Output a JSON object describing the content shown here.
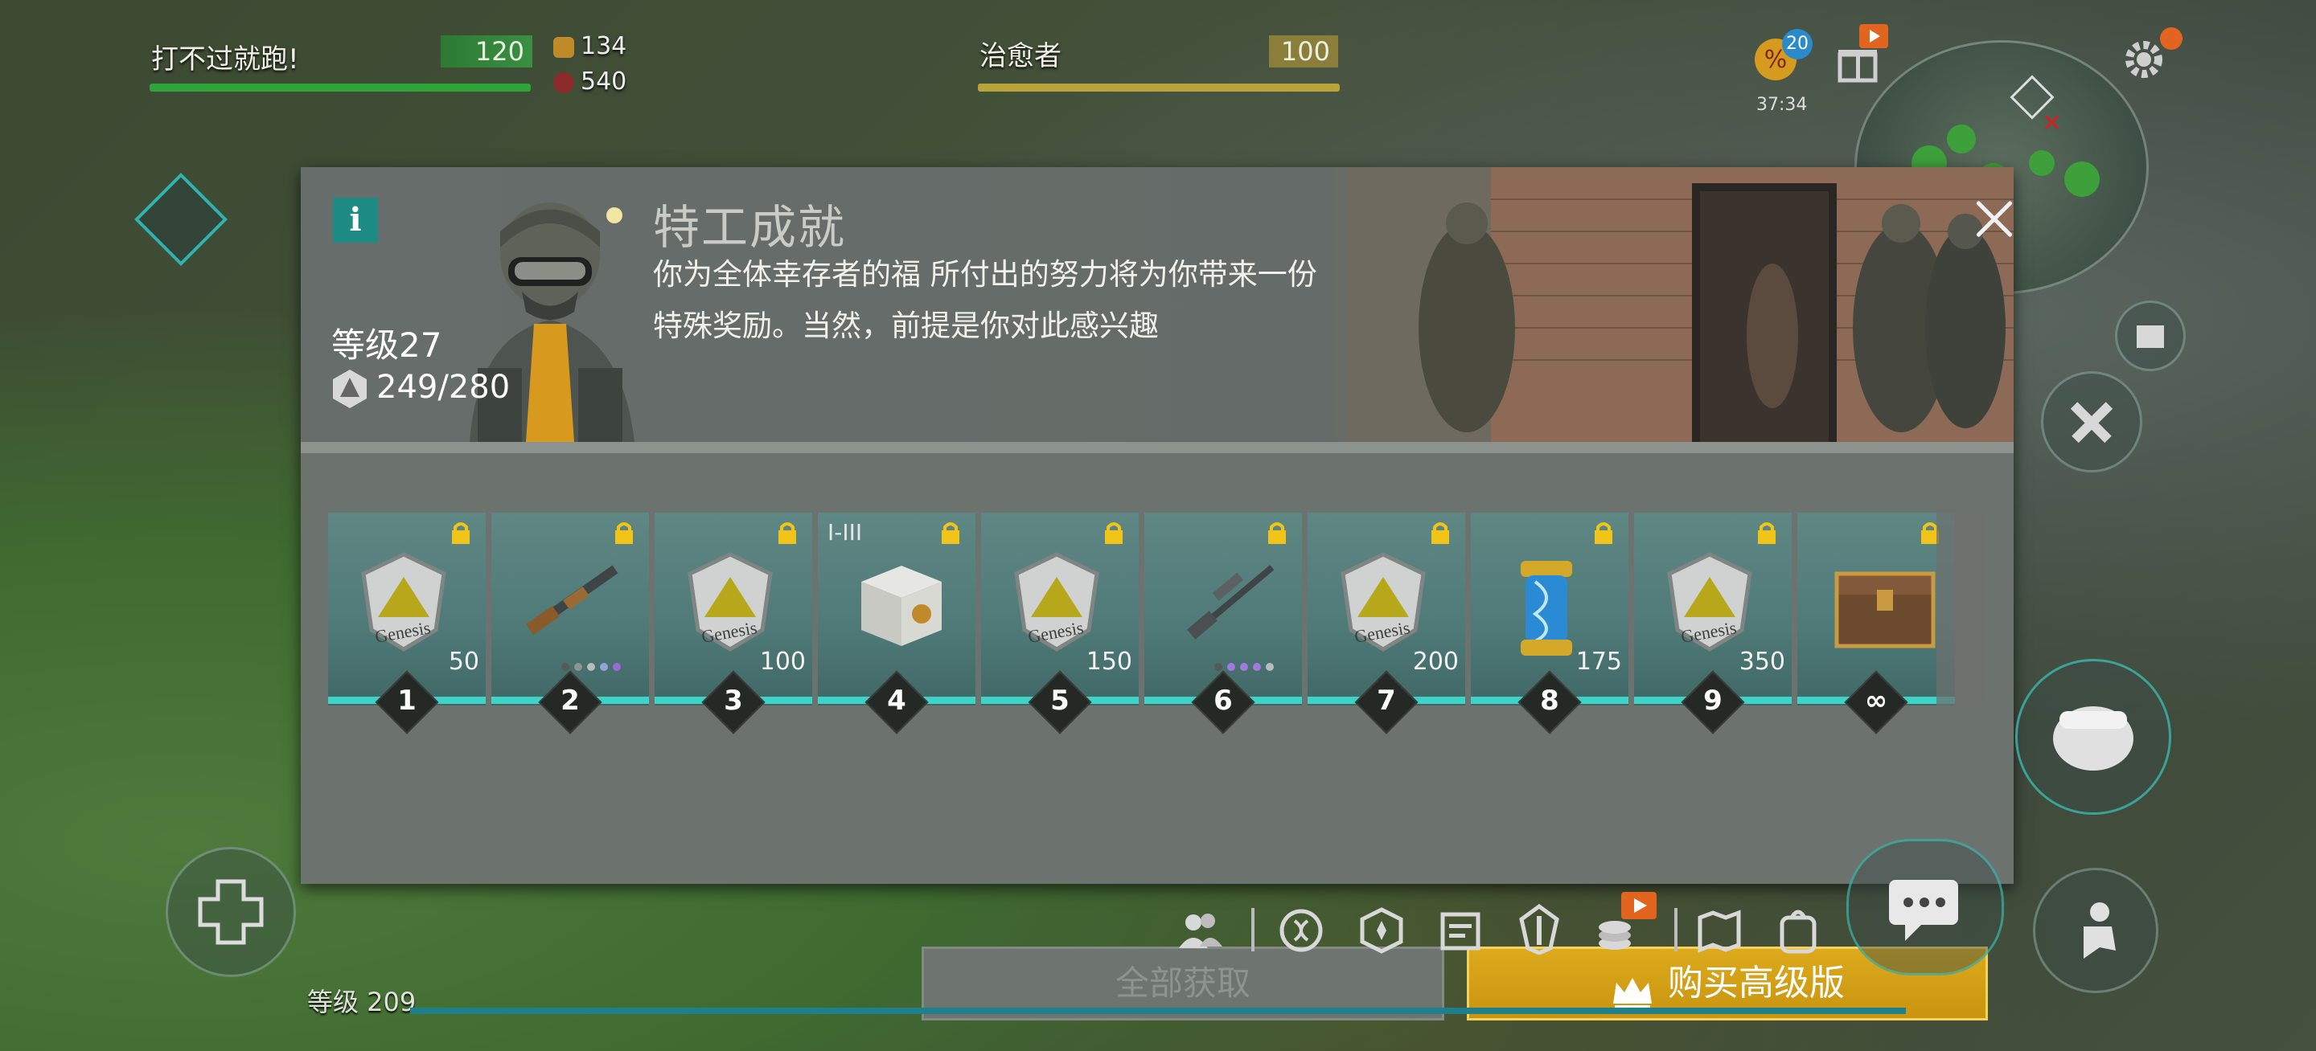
{
  "hud": {
    "player": {
      "name": "打不过就跑!",
      "value": "120"
    },
    "resources": [
      {
        "icon": "bullet-icon",
        "value": "134"
      },
      {
        "icon": "skull-badge-icon",
        "value": "540"
      }
    ],
    "ally": {
      "name": "治愈者",
      "value": "100"
    },
    "event_badge": "20",
    "timer": "37:34"
  },
  "modal": {
    "title": "特工成就",
    "description_line1": "你为全体幸存者的福 所付出的努力将为你带来一份",
    "description_line2": "特殊奖励。当然，前提是你对此感兴趣",
    "level": "等级27",
    "xp": "249/280",
    "rewards": [
      {
        "level": "1",
        "item": "genesis-token-icon",
        "label": "Genesis",
        "amount": "50"
      },
      {
        "level": "2",
        "item": "shotgun-icon",
        "amount": ""
      },
      {
        "level": "3",
        "item": "genesis-token-icon",
        "label": "Genesis",
        "amount": "100"
      },
      {
        "level": "4",
        "item": "supply-box-icon",
        "tier": "I-III",
        "amount": ""
      },
      {
        "level": "5",
        "item": "genesis-token-icon",
        "label": "Genesis",
        "amount": "150"
      },
      {
        "level": "6",
        "item": "sniper-rifle-icon",
        "amount": ""
      },
      {
        "level": "7",
        "item": "genesis-token-icon",
        "label": "Genesis",
        "amount": "200"
      },
      {
        "level": "8",
        "item": "dna-capsule-icon",
        "amount": "175"
      },
      {
        "level": "9",
        "item": "genesis-token-icon",
        "label": "Genesis",
        "amount": "350"
      },
      {
        "level": "∞",
        "item": "treasure-chest-icon",
        "amount": ""
      }
    ],
    "claim_all": "全部获取",
    "buy_premium": "购买高级版"
  },
  "bottom": {
    "level": "等级 209"
  },
  "colors": {
    "accent": "#3fd3c7",
    "premium": "#d4a017",
    "info": "#1d8a83",
    "green_bar": "#2f9a3a",
    "yellow_bar": "#b8a43a"
  }
}
